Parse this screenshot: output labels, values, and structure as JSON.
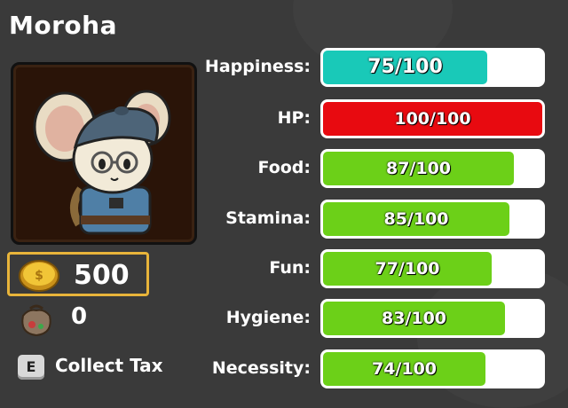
{
  "character": {
    "name": "Moroha"
  },
  "currency": {
    "coins": "500",
    "tax_bag": "0"
  },
  "tax": {
    "key": "E",
    "label": "Collect Tax"
  },
  "colors": {
    "happiness": "#19c9b8",
    "hp": "#e80a10",
    "default": "#6cd018"
  },
  "stats": [
    {
      "label": "Happiness:",
      "value": 75,
      "max": 100,
      "text": "75/100",
      "color_key": "happiness"
    },
    {
      "label": "HP:",
      "value": 100,
      "max": 100,
      "text": "100/100",
      "color_key": "hp"
    },
    {
      "label": "Food:",
      "value": 87,
      "max": 100,
      "text": "87/100",
      "color_key": "default"
    },
    {
      "label": "Stamina:",
      "value": 85,
      "max": 100,
      "text": "85/100",
      "color_key": "default"
    },
    {
      "label": "Fun:",
      "value": 77,
      "max": 100,
      "text": "77/100",
      "color_key": "default"
    },
    {
      "label": "Hygiene:",
      "value": 83,
      "max": 100,
      "text": "83/100",
      "color_key": "default"
    },
    {
      "label": "Necessity:",
      "value": 74,
      "max": 100,
      "text": "74/100",
      "color_key": "default"
    }
  ]
}
